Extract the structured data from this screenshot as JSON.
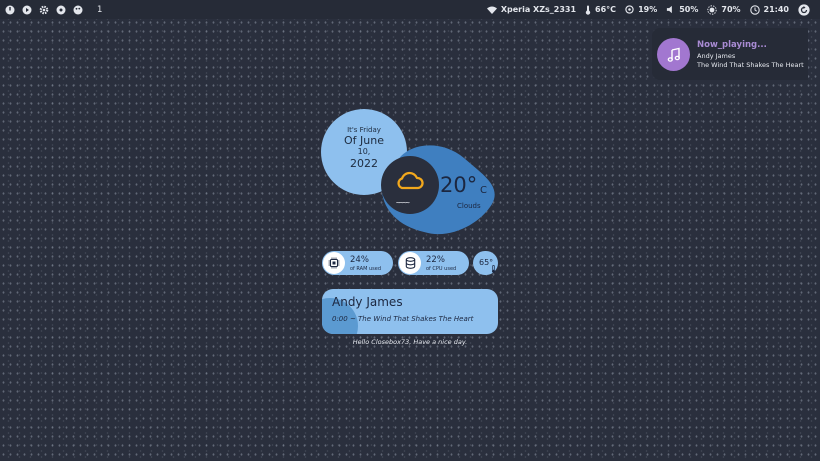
{
  "topbar": {
    "workspace": "1",
    "wifi_name": "Xperia XZs_2331",
    "cpu_temp": "66°C",
    "disk": "19%",
    "volume": "50%",
    "brightness": "70%",
    "time": "21:40",
    "left_icons": [
      "power-icon",
      "play-icon",
      "settings-icon",
      "gear-icon",
      "palette-icon"
    ],
    "right_icons": [
      "wifi-icon",
      "thermometer-icon",
      "disk-icon",
      "volume-icon",
      "brightness-icon",
      "clock-icon",
      "refresh-icon"
    ]
  },
  "notification": {
    "title": "Now_playing...",
    "artist": "Andy James",
    "song": "The Wind That Shakes The Heart",
    "icon": "music-note-icon",
    "accent": "#a277d0"
  },
  "date": {
    "day": "It's Friday",
    "month": "Of June",
    "num": "10,",
    "year": "2022"
  },
  "weather": {
    "temp": "20°",
    "unit": "C",
    "condition": "Clouds",
    "icon": "cloud-icon",
    "fog": "~~~~"
  },
  "stats": {
    "ram_value": "24%",
    "ram_label": "of RAM used",
    "cpu_value": "22%",
    "cpu_label": "of CPU used",
    "temp_value": "65°"
  },
  "music": {
    "artist": "Andy James",
    "line": "0:00 ~ The Wind That Shakes The Heart"
  },
  "greeting": "Hello Closebox73, Have a nice day.",
  "colors": {
    "background": "#2a2f3d",
    "bar": "#262b37",
    "light_blue": "#8ec0ee",
    "dark_blue": "#3f7fc0",
    "cloud": "#f2a81d"
  }
}
